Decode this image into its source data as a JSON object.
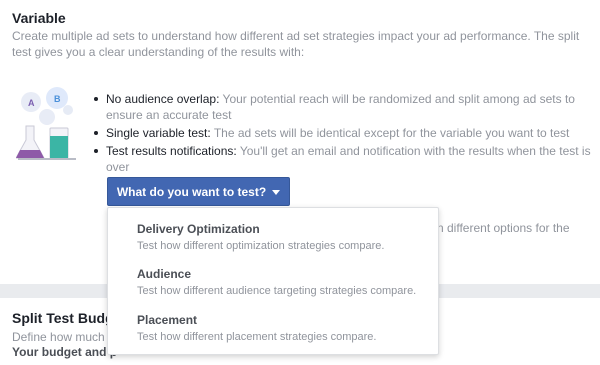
{
  "variable": {
    "title": "Variable",
    "description": "Create multiple ad sets to understand how different ad set strategies impact your ad performance. The split test gives you a clear understanding of the results with:",
    "illustration_labels": {
      "a": "A",
      "b": "B"
    },
    "bullets": [
      {
        "title": "No audience overlap:",
        "text": " Your potential reach will be randomized and split among ad sets to ensure an accurate test"
      },
      {
        "title": "Single variable test:",
        "text": " The ad sets will be identical except for the variable you want to test"
      },
      {
        "title": "Test results notifications:",
        "text": " You'll get an email and notification with the results when the test is over"
      }
    ],
    "button_label": "What do you want to test?",
    "partially_hidden_text": "n different options for the"
  },
  "dropdown": {
    "items": [
      {
        "title": "Delivery Optimization",
        "subtitle": "Test how different optimization strategies compare."
      },
      {
        "title": "Audience",
        "subtitle": "Test how different audience targeting strategies compare."
      },
      {
        "title": "Placement",
        "subtitle": "Test how different placement strategies compare."
      }
    ]
  },
  "budget": {
    "title": "Split Test Budg",
    "desc_fragment": "Define how much y",
    "bold_fragment": "Your budget and p"
  },
  "colors": {
    "primary_button": "#4267b2",
    "text_dark": "#1d2129",
    "text_muted": "#90949c",
    "page_divider": "#e9ebee"
  }
}
